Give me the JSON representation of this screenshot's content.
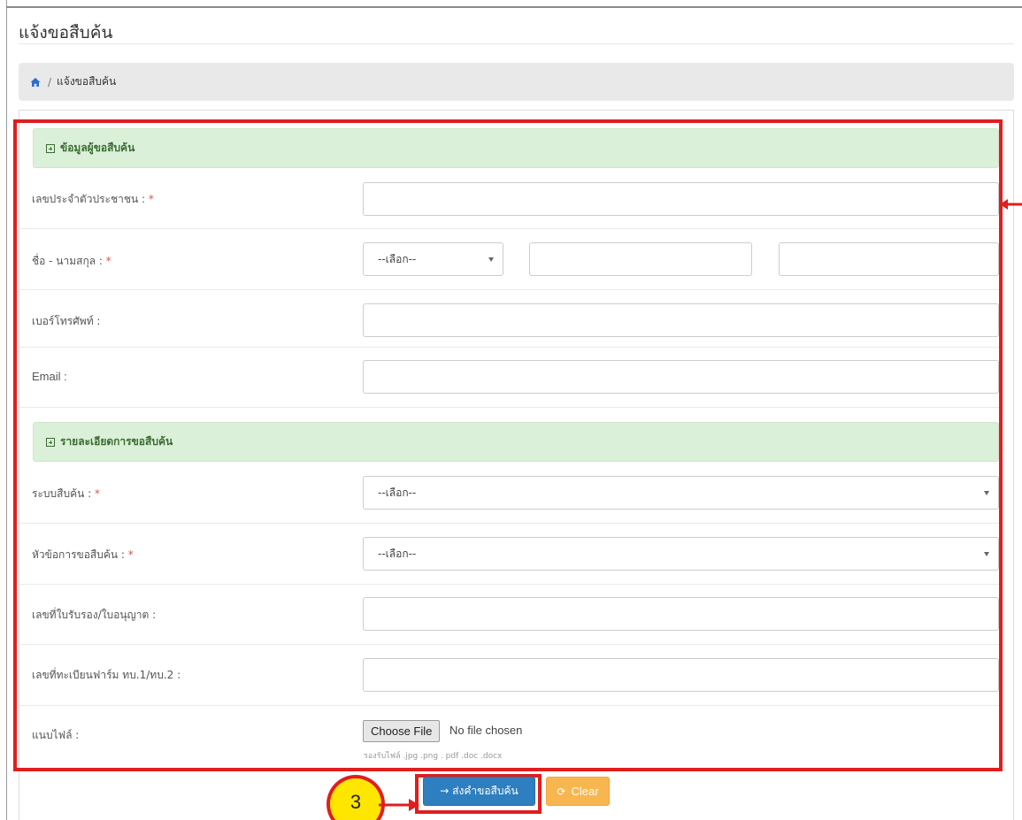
{
  "page": {
    "title": "แจ้งขอสืบค้น"
  },
  "breadcrumb": {
    "current": "แจ้งขอสืบค้น",
    "separator": "/"
  },
  "sections": {
    "requester": {
      "title": "ข้อมูลผู้ขอสืบค้น"
    },
    "details": {
      "title": "รายละเอียดการขอสืบค้น"
    }
  },
  "fields": {
    "citizen_id": {
      "label": "เลขประจำตัวประชาชน :",
      "required": "*"
    },
    "full_name": {
      "label": "ชื่อ - นามสกุล :",
      "required": "*",
      "prefix_value": "--เลือก--"
    },
    "phone": {
      "label": "เบอร์โทรศัพท์ :"
    },
    "email": {
      "label": "Email :"
    },
    "search_system": {
      "label": "ระบบสืบค้น :",
      "required": "*",
      "value": "--เลือก--"
    },
    "search_topic": {
      "label": "หัวข้อการขอสืบค้น :",
      "required": "*",
      "value": "--เลือก--"
    },
    "license_no": {
      "label": "เลขที่ใบรับรอง/ใบอนุญาต :"
    },
    "form_reg_no": {
      "label": "เลขที่ทะเบียนฟาร์ม ทบ.1/ทบ.2 :"
    },
    "attachment": {
      "label": "แนบไฟล์ :",
      "button": "Choose File",
      "status": "No file chosen",
      "hint": "รองรับไฟล์ .jpg .png . pdf .doc .docx"
    }
  },
  "actions": {
    "submit_label": "→ ส่งคำขอสืบค้น",
    "clear_label": "Clear"
  },
  "annotation": {
    "step_number": "3"
  },
  "colors": {
    "highlight": "#e01e1e",
    "section_bg": "#dbf0d8",
    "submit_bg": "#2e7fbf",
    "clear_bg": "#f8b650",
    "badge": "#ffe600"
  }
}
